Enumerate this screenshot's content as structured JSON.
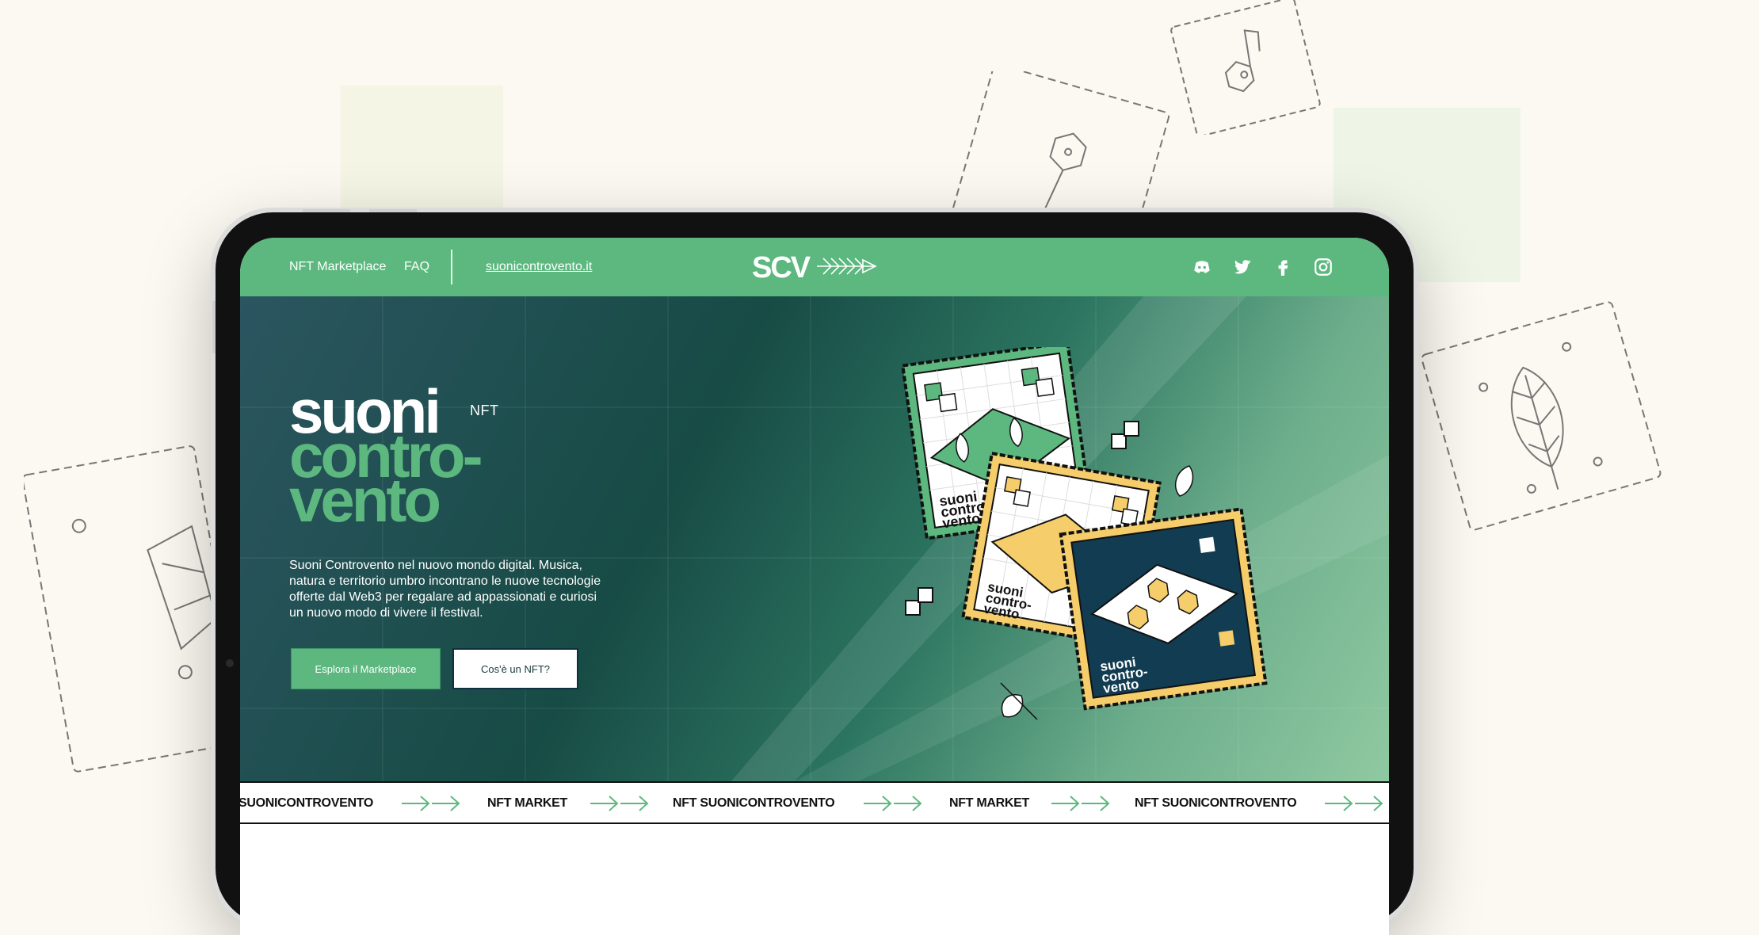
{
  "nav": {
    "links": [
      "NFT Marketplace",
      "FAQ"
    ],
    "external_link": "suonicontrovento.it",
    "logo_text": "SCV",
    "social_icons": [
      "discord-icon",
      "twitter-icon",
      "facebook-icon",
      "instagram-icon"
    ]
  },
  "hero": {
    "title_line1": "suoni",
    "title_superscript": "NFT",
    "title_line2": "contro-",
    "title_line3": "vento",
    "description": "Suoni Controvento nel nuovo mondo digital. Musica, natura e territorio umbro incontrano le nuove tecnologie offerte dal Web3 per regalare ad appassionati e curiosi un nuovo modo di vivere il festival.",
    "primary_button": "Esplora il Marketplace",
    "secondary_button": "Cos'è un NFT?",
    "stamp_label": [
      "suoni",
      "contro-",
      "vento"
    ]
  },
  "ticker": {
    "items": [
      "SUONICONTROVENTO",
      "NFT MARKET",
      "NFT SUONICONTROVENTO",
      "NFT MARKET",
      "NFT SUONICONTROVENTO"
    ]
  },
  "colors": {
    "page_background": "#fbf9f1",
    "brand_green": "#5cb87e",
    "dark_teal": "#174b45",
    "stamp_navy": "#123c52",
    "stamp_yellow": "#f5cd6b"
  }
}
